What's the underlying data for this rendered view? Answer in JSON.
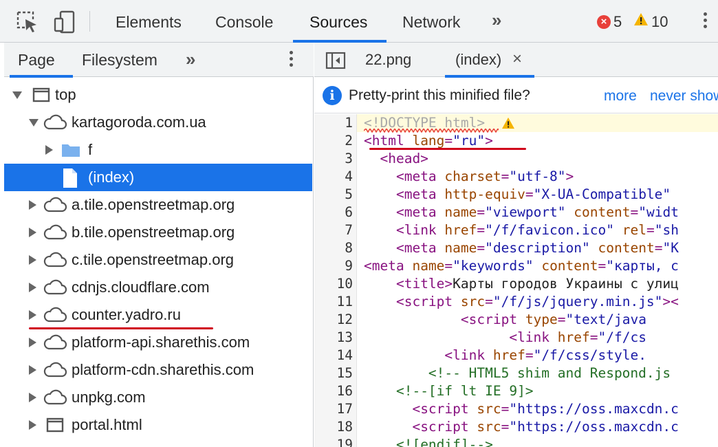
{
  "toolbar": {
    "tabs": [
      "Elements",
      "Console",
      "Sources",
      "Network"
    ],
    "active_tab": "Sources",
    "more_tabs": "»",
    "errors": "5",
    "warnings": "10",
    "icons": [
      "inspect-element-icon",
      "device-toolbar-icon",
      "error-icon",
      "warning-icon",
      "kebab-menu-icon"
    ]
  },
  "navigator": {
    "tabs": [
      "Page",
      "Filesystem"
    ],
    "active_tab": "Page",
    "more": "»",
    "tree": [
      {
        "label": "top",
        "icon": "frame-icon",
        "expand": "down"
      },
      {
        "label": "kartagoroda.com.ua",
        "icon": "cloud-icon",
        "expand": "down"
      },
      {
        "label": "f",
        "icon": "folder-icon",
        "expand": "right"
      },
      {
        "label": "(index)",
        "icon": "file-icon",
        "expand": "none",
        "selected": true
      },
      {
        "label": "a.tile.openstreetmap.org",
        "icon": "cloud-icon",
        "expand": "right"
      },
      {
        "label": "b.tile.openstreetmap.org",
        "icon": "cloud-icon",
        "expand": "right"
      },
      {
        "label": "c.tile.openstreetmap.org",
        "icon": "cloud-icon",
        "expand": "right"
      },
      {
        "label": "cdnjs.cloudflare.com",
        "icon": "cloud-icon",
        "expand": "right"
      },
      {
        "label": "counter.yadro.ru",
        "icon": "cloud-icon",
        "expand": "right"
      },
      {
        "label": "platform-api.sharethis.com",
        "icon": "cloud-icon",
        "expand": "right"
      },
      {
        "label": "platform-cdn.sharethis.com",
        "icon": "cloud-icon",
        "expand": "right"
      },
      {
        "label": "unpkg.com",
        "icon": "cloud-icon",
        "expand": "right"
      },
      {
        "label": "portal.html",
        "icon": "frame-icon",
        "expand": "right"
      }
    ]
  },
  "editor": {
    "tabs": [
      {
        "label": "22.png",
        "closable": false
      },
      {
        "label": "(index)",
        "closable": true,
        "active": true
      }
    ],
    "close_glyph": "×",
    "infobar": {
      "text": "Pretty-print this minified file?",
      "more": "more",
      "never": "never show"
    },
    "lines": [
      {
        "n": "1",
        "indent": "",
        "tokens": [
          [
            "doc",
            "<!DOCTYPE html>"
          ]
        ]
      },
      {
        "n": "2",
        "indent": "",
        "tokens": [
          [
            "tag",
            "<html "
          ],
          [
            "attr",
            "lang"
          ],
          [
            "tag",
            "="
          ],
          [
            "val",
            "\"ru\""
          ],
          [
            "tag",
            ">"
          ]
        ]
      },
      {
        "n": "3",
        "indent": "  ",
        "tokens": [
          [
            "tag",
            "<head>"
          ]
        ]
      },
      {
        "n": "4",
        "indent": "    ",
        "tokens": [
          [
            "tag",
            "<meta "
          ],
          [
            "attr",
            "charset"
          ],
          [
            "tag",
            "="
          ],
          [
            "val",
            "\"utf-8\""
          ],
          [
            "tag",
            ">"
          ]
        ]
      },
      {
        "n": "5",
        "indent": "    ",
        "tokens": [
          [
            "tag",
            "<meta "
          ],
          [
            "attr",
            "http-equiv"
          ],
          [
            "tag",
            "="
          ],
          [
            "val",
            "\"X-UA-Compatible\""
          ],
          [
            "tag",
            " "
          ]
        ]
      },
      {
        "n": "6",
        "indent": "    ",
        "tokens": [
          [
            "tag",
            "<meta "
          ],
          [
            "attr",
            "name"
          ],
          [
            "tag",
            "="
          ],
          [
            "val",
            "\"viewport\""
          ],
          [
            "tag",
            " "
          ],
          [
            "attr",
            "content"
          ],
          [
            "tag",
            "="
          ],
          [
            "val",
            "\"widt"
          ]
        ]
      },
      {
        "n": "7",
        "indent": "    ",
        "tokens": [
          [
            "tag",
            "<link "
          ],
          [
            "attr",
            "href"
          ],
          [
            "tag",
            "="
          ],
          [
            "val",
            "\"/f/favicon.ico\""
          ],
          [
            "tag",
            " "
          ],
          [
            "attr",
            "rel"
          ],
          [
            "tag",
            "="
          ],
          [
            "val",
            "\"sh"
          ]
        ]
      },
      {
        "n": "8",
        "indent": "    ",
        "tokens": [
          [
            "tag",
            "<meta "
          ],
          [
            "attr",
            "name"
          ],
          [
            "tag",
            "="
          ],
          [
            "val",
            "\"description\""
          ],
          [
            "tag",
            " "
          ],
          [
            "attr",
            "content"
          ],
          [
            "tag",
            "="
          ],
          [
            "val",
            "\"K"
          ]
        ]
      },
      {
        "n": "9",
        "indent": "",
        "tokens": [
          [
            "tag",
            "<meta "
          ],
          [
            "attr",
            "name"
          ],
          [
            "tag",
            "="
          ],
          [
            "val",
            "\"keywords\""
          ],
          [
            "tag",
            " "
          ],
          [
            "attr",
            "content"
          ],
          [
            "tag",
            "="
          ],
          [
            "val",
            "\"карты, с"
          ]
        ]
      },
      {
        "n": "10",
        "indent": "    ",
        "tokens": [
          [
            "tag",
            "<title>"
          ],
          [
            "text",
            "Карты городов Украины с улиц"
          ]
        ]
      },
      {
        "n": "11",
        "indent": "    ",
        "tokens": [
          [
            "tag",
            "<script "
          ],
          [
            "attr",
            "src"
          ],
          [
            "tag",
            "="
          ],
          [
            "val",
            "\"/f/js/jquery.min.js\""
          ],
          [
            "tag",
            "><"
          ]
        ]
      },
      {
        "n": "12",
        "indent": "            ",
        "tokens": [
          [
            "tag",
            "<script "
          ],
          [
            "attr",
            "type"
          ],
          [
            "tag",
            "="
          ],
          [
            "val",
            "\"text/java"
          ]
        ]
      },
      {
        "n": "13",
        "indent": "                  ",
        "tokens": [
          [
            "tag",
            "<link "
          ],
          [
            "attr",
            "href"
          ],
          [
            "tag",
            "="
          ],
          [
            "val",
            "\"/f/cs"
          ]
        ]
      },
      {
        "n": "14",
        "indent": "          ",
        "tokens": [
          [
            "tag",
            "<link "
          ],
          [
            "attr",
            "href"
          ],
          [
            "tag",
            "="
          ],
          [
            "val",
            "\"/f/css/style."
          ]
        ]
      },
      {
        "n": "15",
        "indent": "        ",
        "tokens": [
          [
            "com",
            "<!-- HTML5 shim and Respond.js"
          ]
        ]
      },
      {
        "n": "16",
        "indent": "    ",
        "tokens": [
          [
            "com",
            "<!--[if lt IE 9]>"
          ]
        ]
      },
      {
        "n": "17",
        "indent": "      ",
        "tokens": [
          [
            "tag",
            "<script "
          ],
          [
            "attr",
            "src"
          ],
          [
            "tag",
            "="
          ],
          [
            "val",
            "\"https://oss.maxcdn.c"
          ]
        ]
      },
      {
        "n": "18",
        "indent": "      ",
        "tokens": [
          [
            "tag",
            "<script "
          ],
          [
            "attr",
            "src"
          ],
          [
            "tag",
            "="
          ],
          [
            "val",
            "\"https://oss.maxcdn.c"
          ]
        ]
      },
      {
        "n": "19",
        "indent": "    ",
        "tokens": [
          [
            "com",
            "<![endif]-->"
          ]
        ]
      }
    ]
  },
  "colors": {
    "accent": "#1a73e8",
    "annotation_red": "#d0021b",
    "error": "#e8403a",
    "warning": "#f5b400"
  }
}
